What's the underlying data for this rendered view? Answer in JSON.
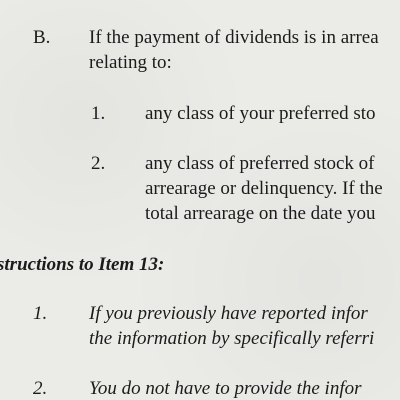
{
  "section_b": {
    "label": "B.",
    "line1": "If the payment of dividends is in arrea",
    "line2": "relating to:"
  },
  "item_1": {
    "number": "1.",
    "text": "any class of your preferred sto"
  },
  "item_2": {
    "number": "2.",
    "line1": "any class of preferred stock of",
    "line2": "arrearage or delinquency. If the",
    "line3": "total arrearage on the date you"
  },
  "instructions": {
    "heading": "structions to Item 13:",
    "inst_1": {
      "number": "1.",
      "line1": "If you previously have reported infor",
      "line2": "the information by specifically referri"
    },
    "inst_2": {
      "number": "2.",
      "line1": "You do not have to provide the infor"
    }
  }
}
